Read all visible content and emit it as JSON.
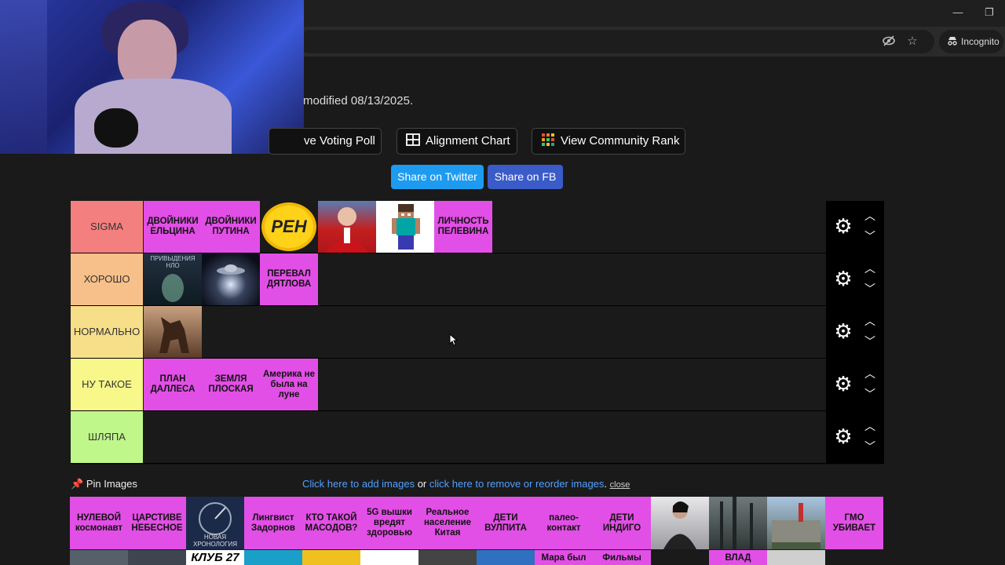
{
  "browser": {
    "incognito_label": "Incognito"
  },
  "page": {
    "modified_text": "modified 08/13/2025.",
    "buttons": {
      "voting_poll": "ve Voting Poll",
      "alignment_chart": "Alignment Chart",
      "community_rank": "View Community Rank"
    },
    "share": {
      "twitter": "Share on Twitter",
      "fb": "Share on FB"
    }
  },
  "tiers": [
    {
      "label": "SIGMA",
      "color": "#f47f7f",
      "items": [
        "ДВОЙНИКИ ЕЛЬЦИНА",
        "ДВОЙНИКИ ПУТИНА",
        "РЕН",
        "",
        "",
        "ЛИЧНОСТЬ ПЕЛЕВИНА"
      ]
    },
    {
      "label": "ХОРОШО",
      "color": "#f7c08a",
      "items": [
        "ПРИВЫДЕНИЯ НЛО",
        "",
        "ПЕРЕВАЛ ДЯТЛОВА"
      ]
    },
    {
      "label": "НОРМАЛЬНО",
      "color": "#f7df8a",
      "items": [
        ""
      ]
    },
    {
      "label": "НУ ТАКОЕ",
      "color": "#f7f78a",
      "items": [
        "ПЛАН ДАЛЛЕСА",
        "ЗЕМЛЯ ПЛОСКАЯ",
        "Америка не была на луне"
      ]
    },
    {
      "label": "ШЛЯПА",
      "color": "#bff78a",
      "items": []
    }
  ],
  "pin": {
    "label": "Pin Images",
    "add_link": "Click here to add images",
    "or": " or ",
    "remove_link": "click here to remove or reorder images",
    "period": ". ",
    "close": "close"
  },
  "pool_items": [
    "НУЛЕВОЙ космонавт",
    "ЦАРСТИВЕ НЕБЕСНОЕ",
    "НОВАЯ ХРОНОЛОГИЯ",
    "Лингвист Задорнов",
    "КТО ТАКОЙ МАСОДОВ?",
    "5G вышки вредят здоровью",
    "Реальное население Китая",
    "ДЕТИ ВУЛПИТА",
    "палео-контакт",
    "ДЕТИ ИНДИГО",
    "",
    "",
    "",
    "ГМО УБИВАЕТ"
  ],
  "pool_row2": [
    "",
    "",
    "КЛУБ 27",
    "",
    "",
    "",
    "",
    "",
    "Мара был",
    "Фильмы",
    "",
    "ВЛАД",
    ""
  ],
  "colors": {
    "pink": "#e24fe6",
    "twitter": "#1d9bf0",
    "fb": "#3b5bc8",
    "link": "#4fa0ff"
  }
}
